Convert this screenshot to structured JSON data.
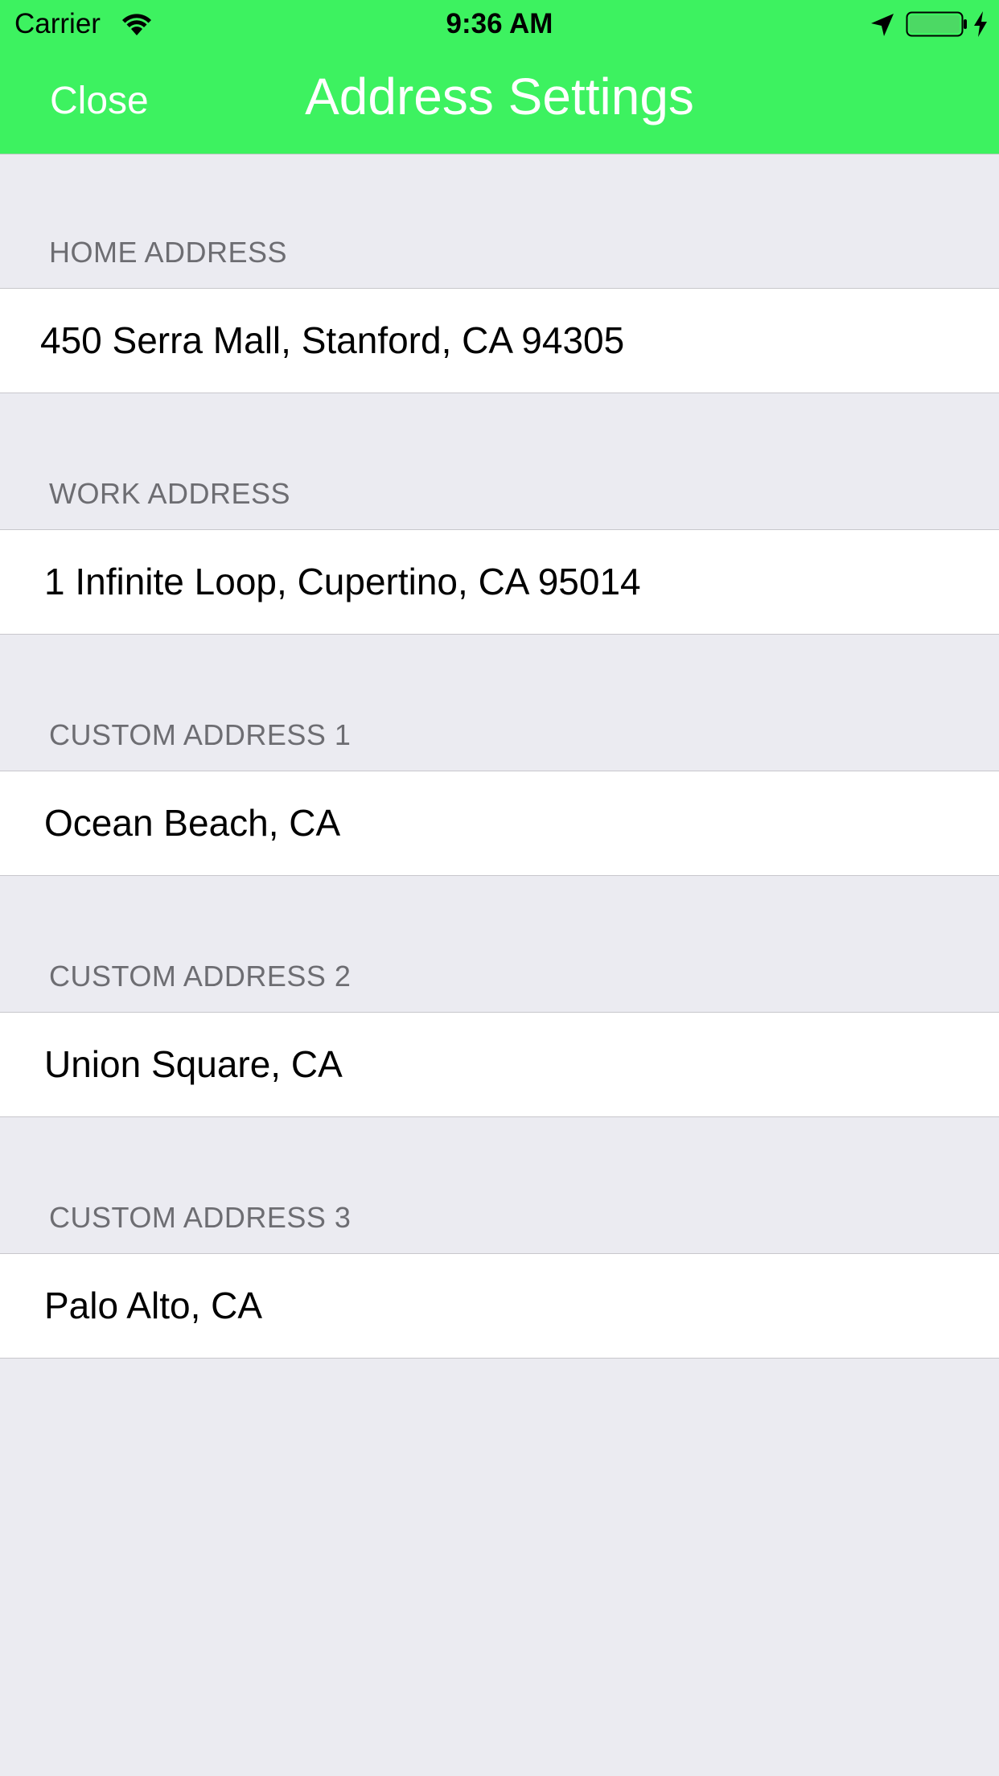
{
  "status_bar": {
    "carrier": "Carrier",
    "time": "9:36 AM"
  },
  "navbar": {
    "close_label": "Close",
    "title": "Address Settings",
    "background_color": "#3df260"
  },
  "sections": [
    {
      "header": "HOME ADDRESS",
      "value": "450 Serra Mall, Stanford, CA 94305"
    },
    {
      "header": "WORK ADDRESS",
      "value": "1 Infinite Loop, Cupertino, CA 95014"
    },
    {
      "header": "CUSTOM ADDRESS 1",
      "value": "Ocean Beach, CA"
    },
    {
      "header": "CUSTOM ADDRESS 2",
      "value": "Union Square, CA"
    },
    {
      "header": "CUSTOM ADDRESS 3",
      "value": "Palo Alto, CA"
    }
  ]
}
